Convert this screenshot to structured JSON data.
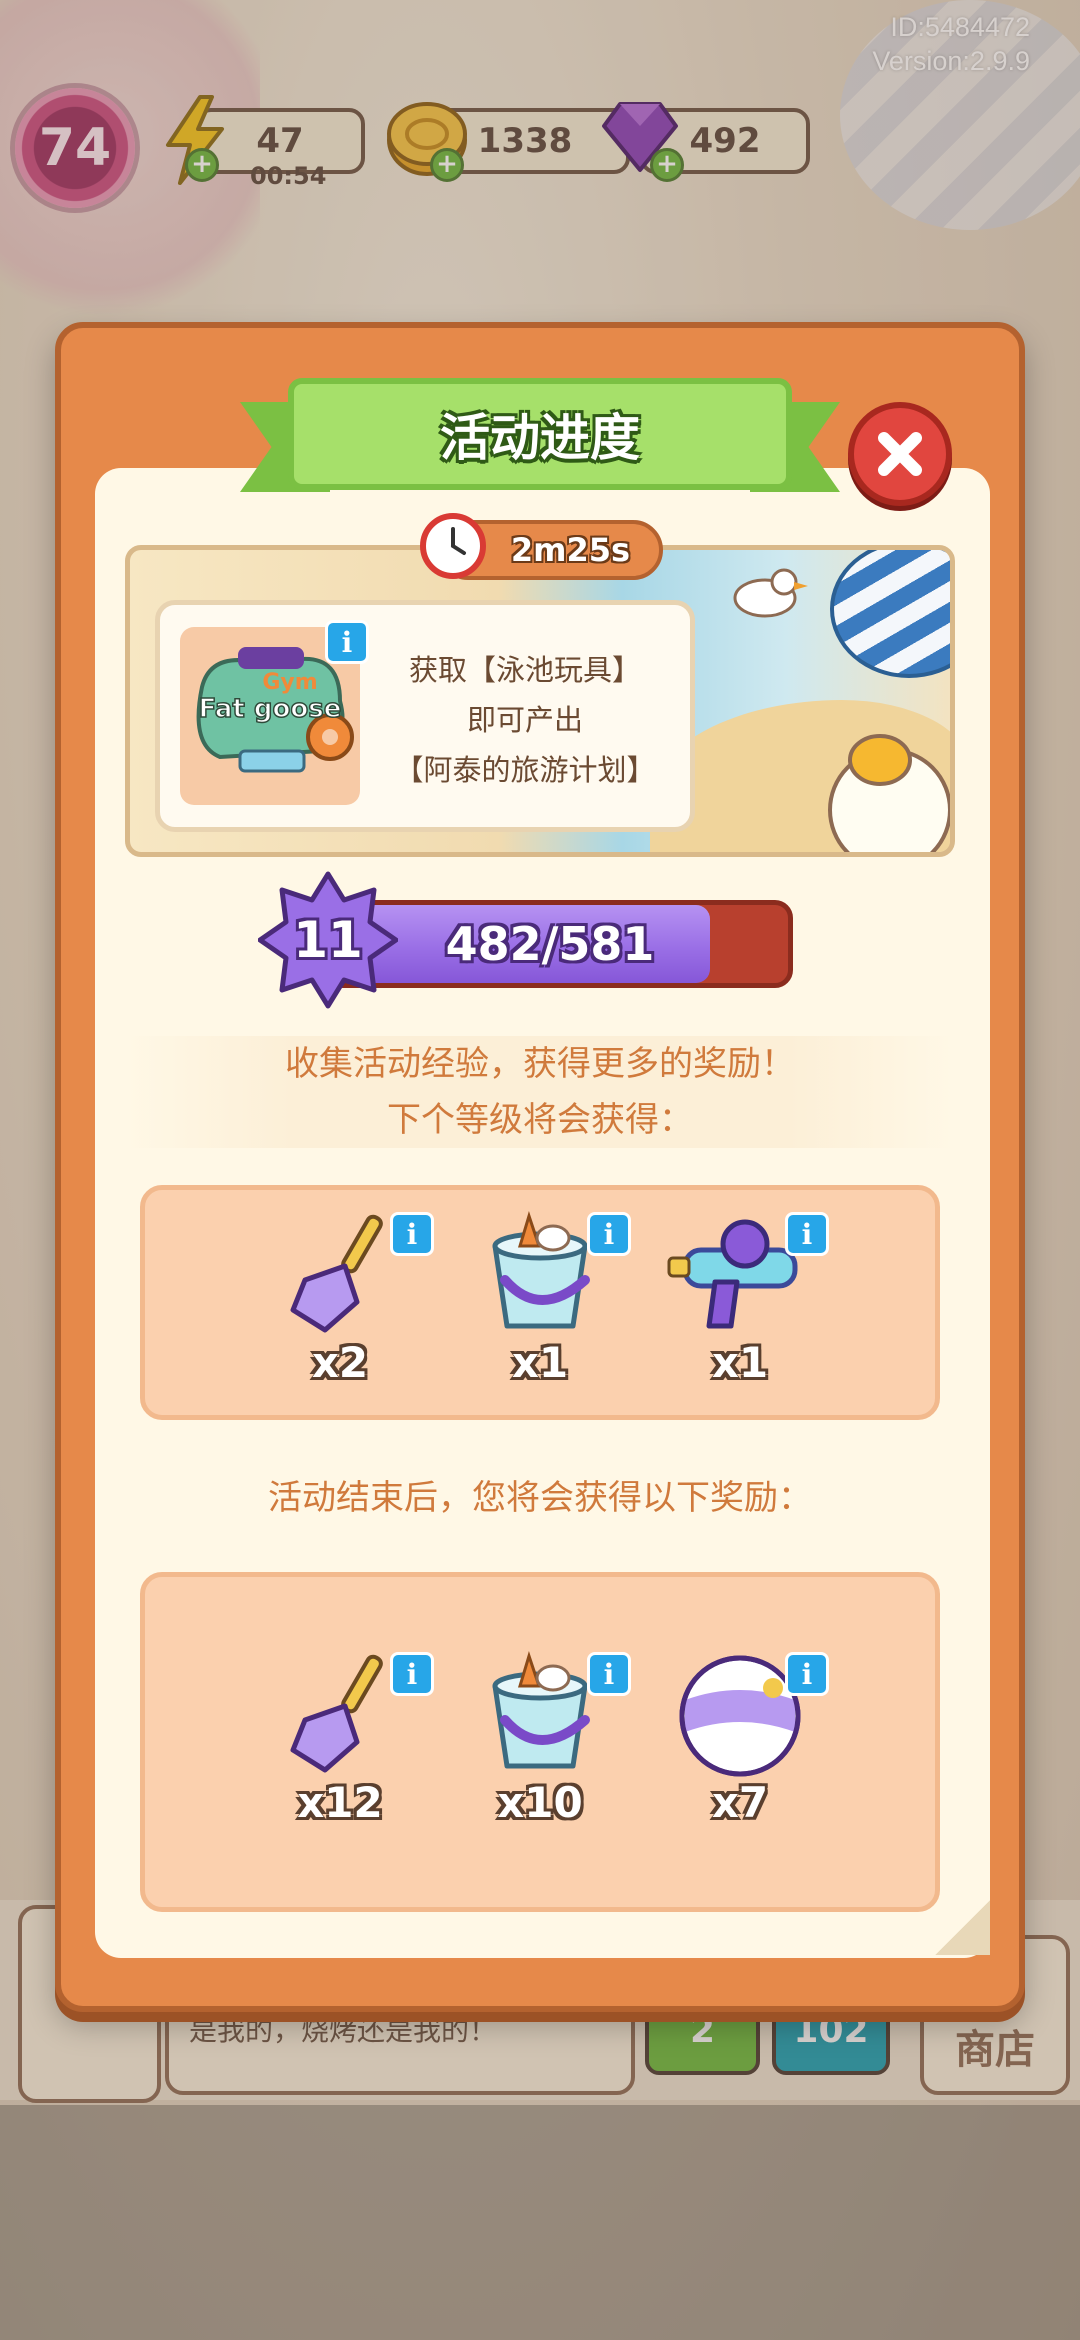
{
  "build": {
    "id": "ID:5484472",
    "version": "Version:2.9.9"
  },
  "hud": {
    "player_level": "74",
    "energy": "47",
    "energy_timer": "00:54",
    "coins": "1338",
    "gems": "492"
  },
  "modal": {
    "title": "活动进度",
    "timer": "2m25s",
    "event_description": {
      "line1": "获取【泳池玩具】",
      "line2": "即可产出",
      "line3": "【阿泰的旅游计划】"
    },
    "progress": {
      "level": "11",
      "text": "482/581",
      "current": 482,
      "max": 581
    },
    "next_level_caption_1": "收集活动经验，获得更多的奖励！",
    "next_level_caption_2": "下个等级将会获得：",
    "next_rewards": [
      {
        "icon": "shovel-icon",
        "count": "x2"
      },
      {
        "icon": "sand-bucket-icon",
        "count": "x1"
      },
      {
        "icon": "water-gun-icon",
        "count": "x1"
      }
    ],
    "end_caption": "活动结束后，您将会获得以下奖励：",
    "final_rewards": [
      {
        "icon": "shovel-icon",
        "count": "x12"
      },
      {
        "icon": "sand-bucket-icon",
        "count": "x10"
      },
      {
        "icon": "beach-ball-icon",
        "count": "x7"
      }
    ]
  },
  "background": {
    "chat_text": "是我的，烧烤还是我的！",
    "green_button": "2",
    "teal_button": "102",
    "shop_label": "商店"
  },
  "colors": {
    "modal_orange": "#e6894a",
    "title_green": "#a6e06a",
    "progress_purple": "#9a6fe6",
    "caption_orange": "#d07a3c",
    "info_blue": "#27a6e8",
    "close_red": "#e1463f"
  }
}
